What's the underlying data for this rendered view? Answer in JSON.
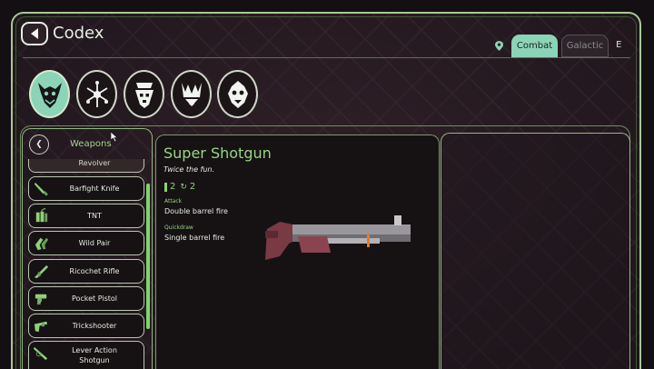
{
  "header": {
    "title": "Codex",
    "key_hint": "E"
  },
  "tabs": [
    {
      "label": "Combat",
      "active": true
    },
    {
      "label": "Galactic",
      "active": false
    }
  ],
  "categories": [
    {
      "icon": "demon-face-icon",
      "active": true
    },
    {
      "icon": "shattered-star-icon",
      "active": false
    },
    {
      "icon": "crowned-skull-icon",
      "active": false
    },
    {
      "icon": "trident-emblem-icon",
      "active": false
    },
    {
      "icon": "ornate-mask-icon",
      "active": false
    }
  ],
  "weapons_list": {
    "title": "Weapons",
    "items": [
      {
        "label": "Revolver",
        "icon": "revolver-icon"
      },
      {
        "label": "Barfight Knife",
        "icon": "knife-icon"
      },
      {
        "label": "TNT",
        "icon": "tnt-icon"
      },
      {
        "label": "Wild Pair",
        "icon": "wild-pair-icon"
      },
      {
        "label": "Ricochet Rifle",
        "icon": "rifle-icon"
      },
      {
        "label": "Pocket Pistol",
        "icon": "pistol-icon"
      },
      {
        "label": "Trickshooter",
        "icon": "trickshooter-icon"
      },
      {
        "label": "Lever Action\nShotgun",
        "icon": "lever-shotgun-icon"
      }
    ]
  },
  "detail": {
    "name": "Super Shotgun",
    "tagline": "Twice the fun.",
    "ammo": "2",
    "reload": "2",
    "attack_label": "Attack",
    "attack_value": "Double barrel fire",
    "quickdraw_label": "Quickdraw",
    "quickdraw_value": "Single barrel fire"
  },
  "colors": {
    "accent": "#8bd4b8",
    "green": "#96d782",
    "frame": "#a8c994"
  }
}
